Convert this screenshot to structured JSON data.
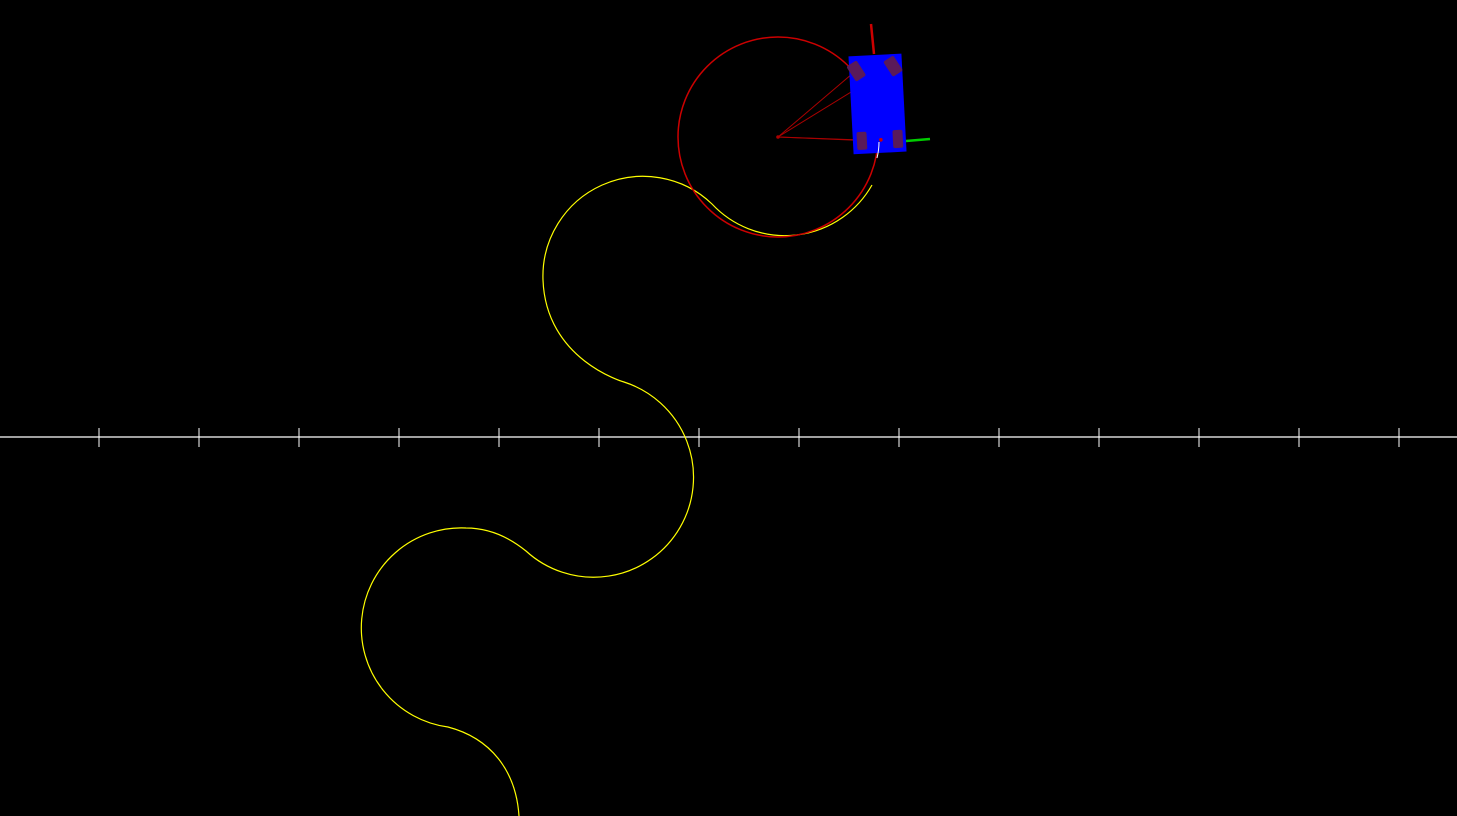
{
  "scene": {
    "background_color": "#000000",
    "axis_color": "#ffffff",
    "path_color": "#ffff00",
    "turn_circle_color": "#cc0000",
    "vehicle_body_color": "#0000ff",
    "wheel_color": "#5a1a5a",
    "steering_line_color": "#aa0000",
    "heading_marker_color": "#cc0000",
    "side_marker_color": "#00cc00",
    "axis_tick_count": 14
  }
}
